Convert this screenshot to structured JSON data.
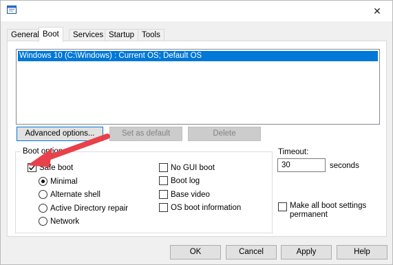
{
  "window": {
    "close_glyph": "✕"
  },
  "tabs": [
    {
      "label": "General"
    },
    {
      "label": "Boot"
    },
    {
      "label": "Services"
    },
    {
      "label": "Startup"
    },
    {
      "label": "Tools"
    }
  ],
  "os_list": [
    "Windows 10 (C:\\Windows) : Current OS; Default OS"
  ],
  "buttons": {
    "advanced": "Advanced options...",
    "set_default": "Set as default",
    "delete": "Delete",
    "ok": "OK",
    "cancel": "Cancel",
    "apply": "Apply",
    "help": "Help"
  },
  "boot_options": {
    "label": "Boot options",
    "safe_boot": {
      "label": "Safe boot",
      "checked": true
    },
    "safe_modes": [
      {
        "label": "Minimal",
        "selected": true
      },
      {
        "label": "Alternate shell",
        "selected": false
      },
      {
        "label": "Active Directory repair",
        "selected": false
      },
      {
        "label": "Network",
        "selected": false
      }
    ],
    "other": [
      {
        "label": "No GUI boot",
        "checked": false
      },
      {
        "label": "Boot log",
        "checked": false
      },
      {
        "label": "Base video",
        "checked": false
      },
      {
        "label": "OS boot information",
        "checked": false
      }
    ]
  },
  "timeout": {
    "label": "Timeout:",
    "value": "30",
    "unit": "seconds"
  },
  "permanent": {
    "label_line1": "Make all boot settings",
    "label_line2": "permanent",
    "checked": false
  },
  "annotation": {
    "arrow_color": "#e8414b"
  }
}
